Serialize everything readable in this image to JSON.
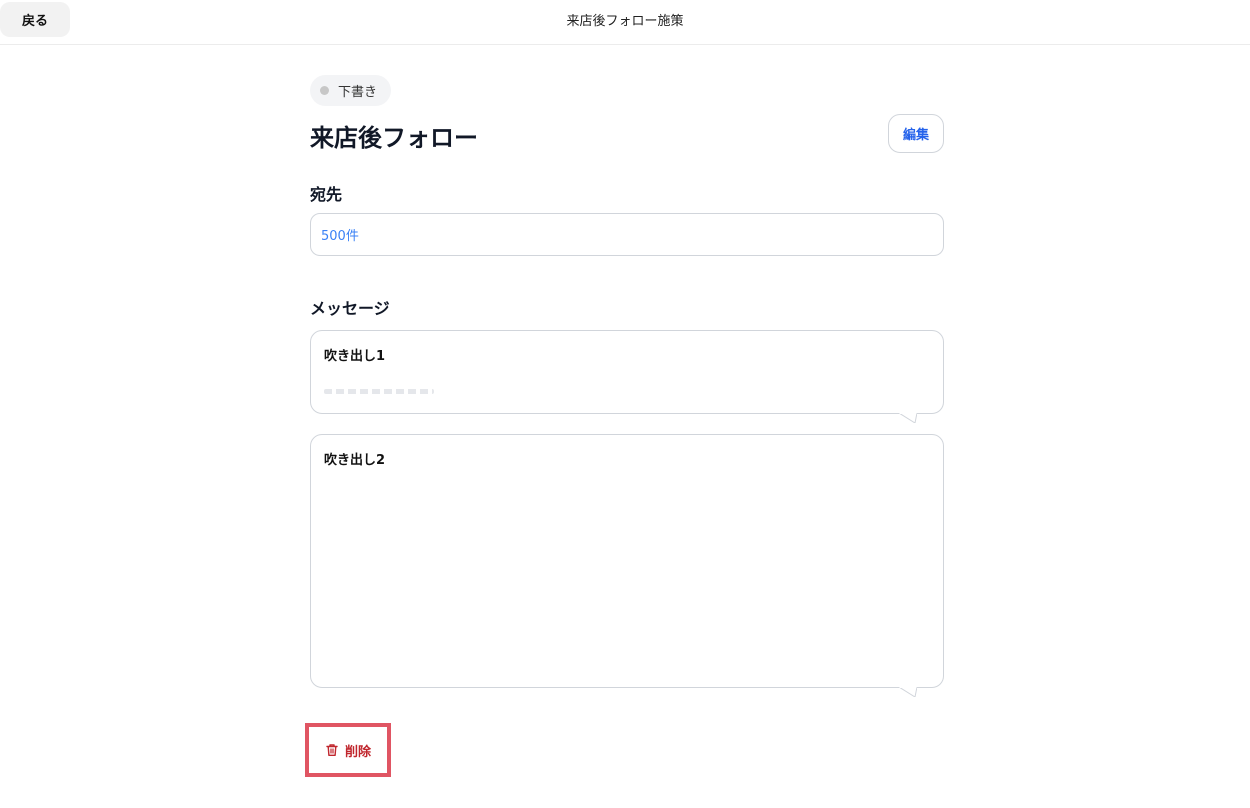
{
  "header": {
    "back_label": "戻る",
    "title": "来店後フォロー施策"
  },
  "campaign": {
    "status": "下書き",
    "title": "来店後フォロー",
    "edit_label": "編集"
  },
  "recipients": {
    "label": "宛先",
    "value": "500件"
  },
  "messages": {
    "label": "メッセージ",
    "bubbles": [
      {
        "title": "吹き出し1"
      },
      {
        "title": "吹き出し2"
      }
    ]
  },
  "actions": {
    "delete_label": "削除"
  },
  "colors": {
    "accent": "#2563eb",
    "danger": "#c0262d",
    "highlight": "#e05563"
  },
  "icons": {
    "delete": "trash-icon"
  }
}
